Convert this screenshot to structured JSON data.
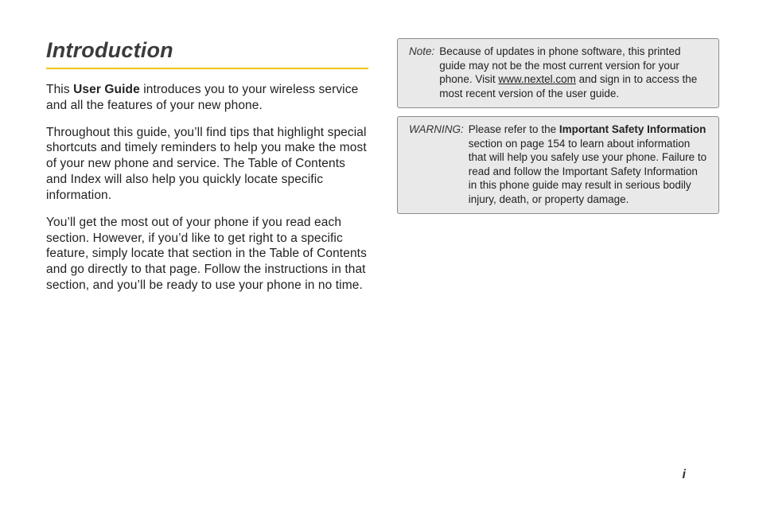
{
  "heading": "Introduction",
  "left": {
    "p1_pre": "This ",
    "p1_bold": "User Guide",
    "p1_post": " introduces you to your wireless service and all the features of your new phone.",
    "p2": "Throughout this guide, you’ll find tips that highlight special shortcuts and timely reminders to help you make the most of your new phone and service. The Table of Contents and Index will also help you quickly locate specific information.",
    "p3": "You’ll get the most out of your phone if you read each section. However, if you’d like to get right to a specific feature, simply locate that section in the Table of Contents and go directly to that page. Follow the instructions in that section, and you’ll be ready to use your phone in no time."
  },
  "note": {
    "label": "Note:",
    "body_pre": "Because of updates in phone software, this printed guide may not be the most current version for your phone. Visit ",
    "link": "www.nextel.com",
    "body_post": " and sign in to access the most recent version of the user guide."
  },
  "warning": {
    "label": "WARNING:",
    "body_pre": "Please refer to the ",
    "bold": "Important Safety Information",
    "body_post": " section on page 154 to learn about information that will help you safely use your phone. Failure to read and follow the Important Safety Information in this phone guide may result in serious bodily injury, death, or property damage."
  },
  "page_number": "i"
}
